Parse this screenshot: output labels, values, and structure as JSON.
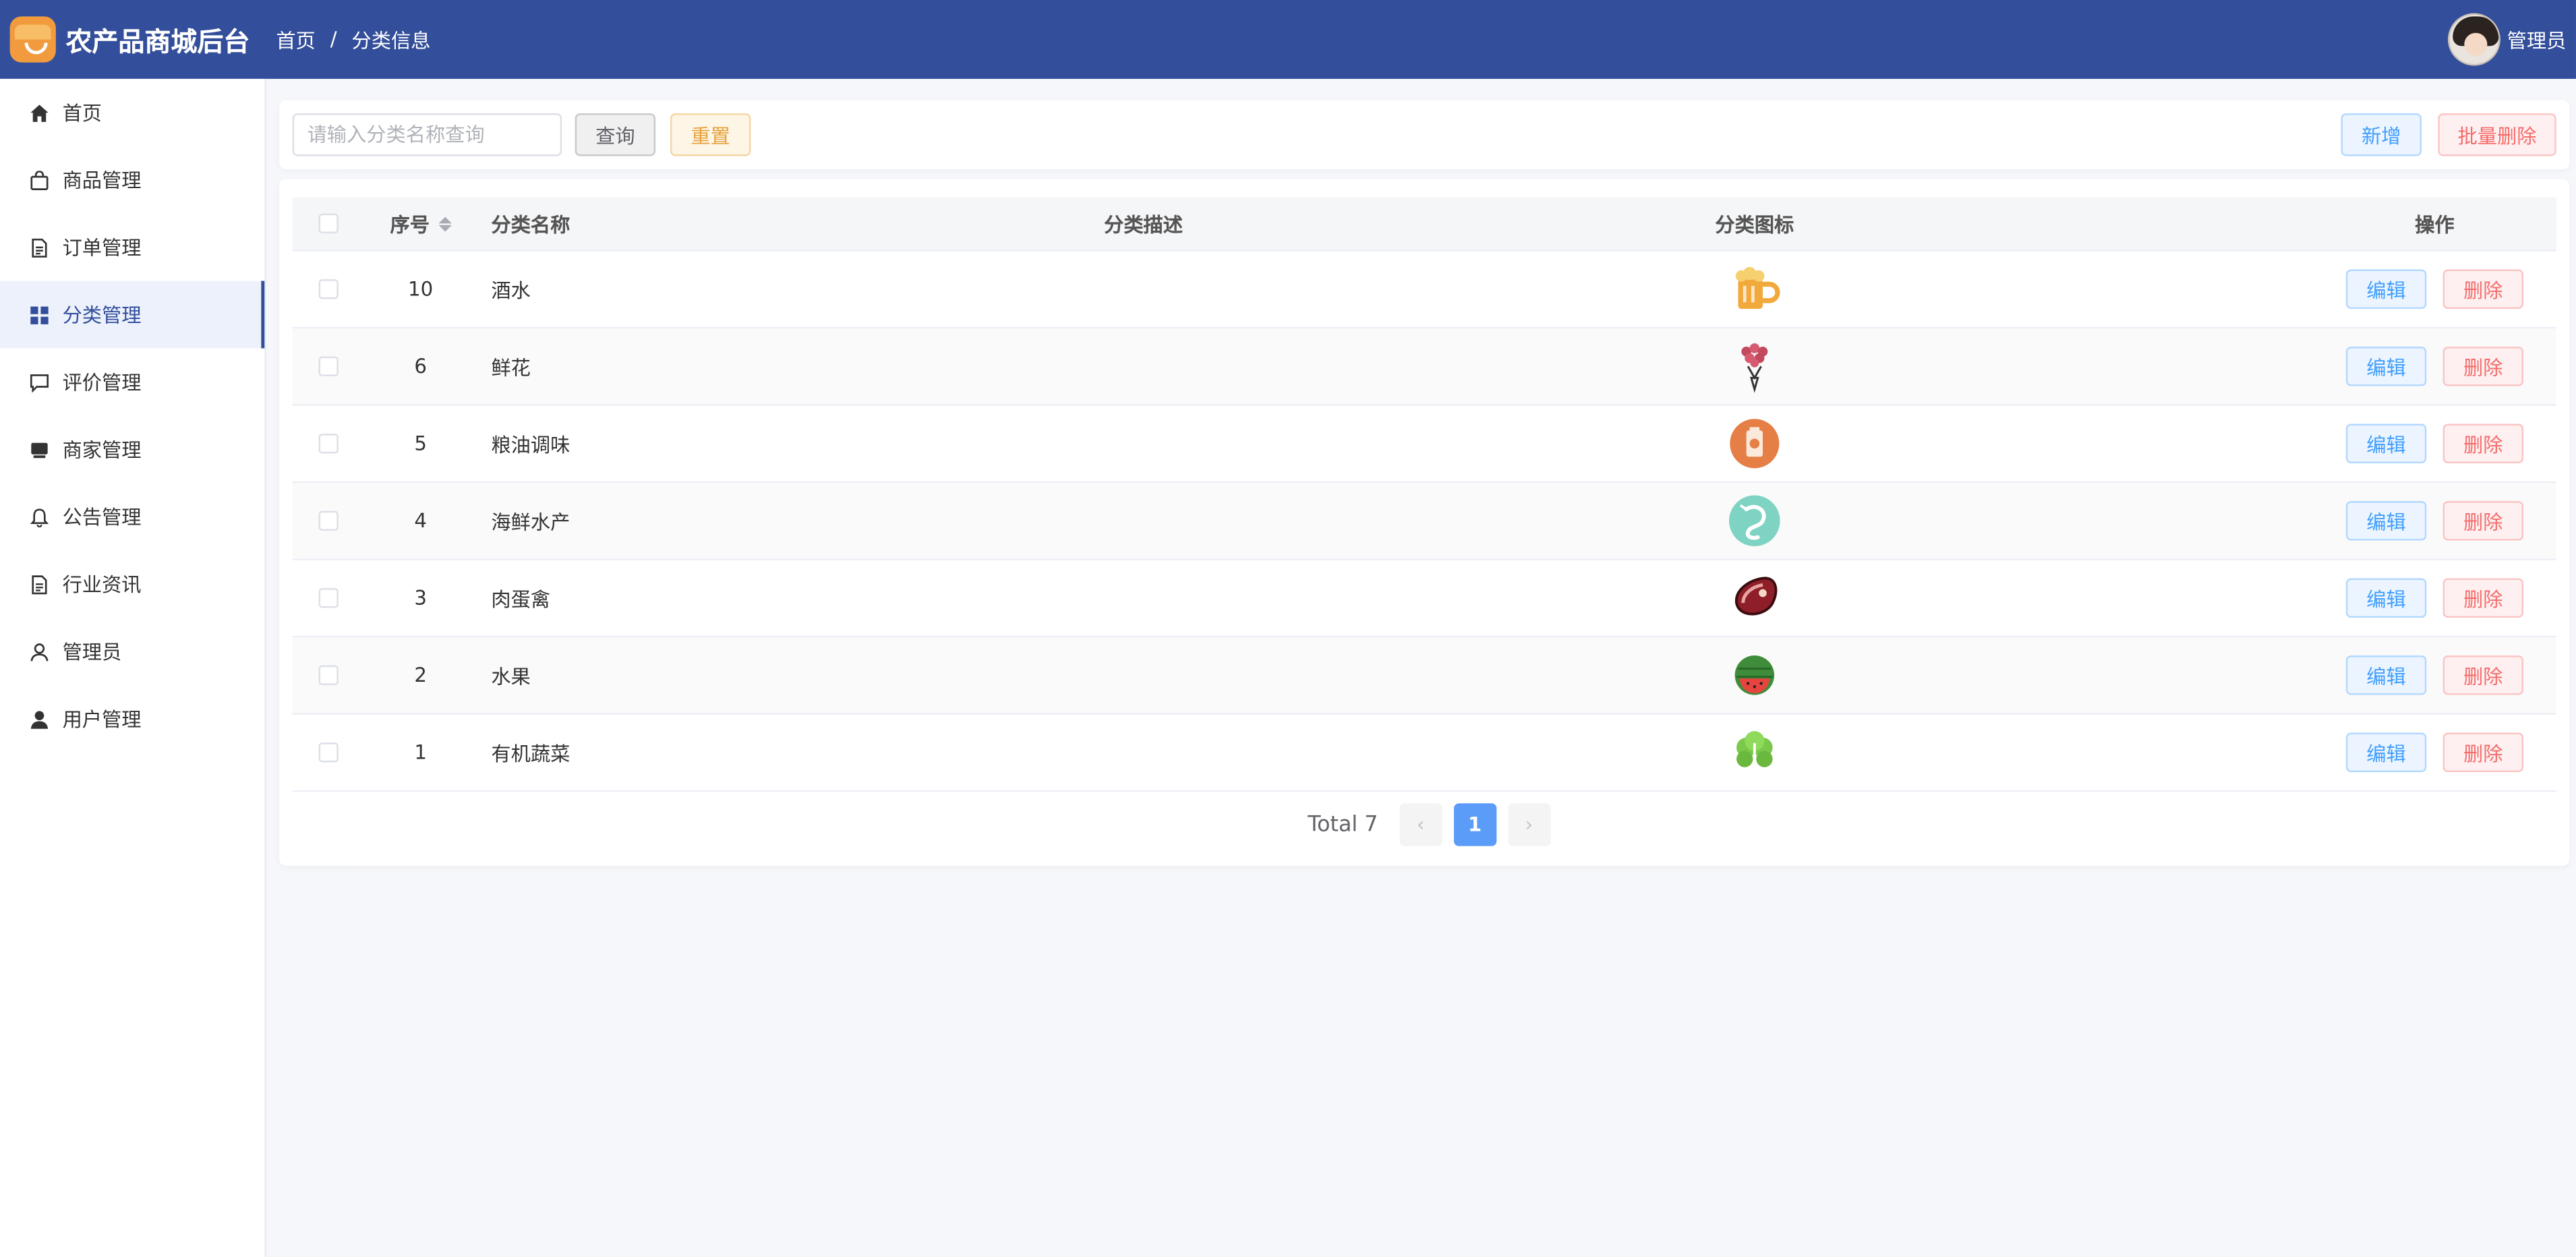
{
  "header": {
    "app_title": "农产品商城后台",
    "breadcrumb": [
      "首页",
      "分类信息"
    ],
    "user_name": "管理员",
    "bg_color": "#334e9a"
  },
  "sidebar": {
    "items": [
      {
        "label": "首页",
        "icon": "home-icon"
      },
      {
        "label": "商品管理",
        "icon": "shopping-bag-icon"
      },
      {
        "label": "订单管理",
        "icon": "document-icon"
      },
      {
        "label": "分类管理",
        "icon": "grid-icon",
        "active": true
      },
      {
        "label": "评价管理",
        "icon": "chat-icon"
      },
      {
        "label": "商家管理",
        "icon": "store-icon"
      },
      {
        "label": "公告管理",
        "icon": "bell-icon"
      },
      {
        "label": "行业资讯",
        "icon": "document-icon"
      },
      {
        "label": "管理员",
        "icon": "user-icon"
      },
      {
        "label": "用户管理",
        "icon": "user-filled-icon"
      }
    ]
  },
  "toolbar": {
    "search_placeholder": "请输入分类名称查询",
    "query_label": "查询",
    "reset_label": "重置",
    "add_label": "新增",
    "batch_delete_label": "批量删除"
  },
  "table": {
    "columns": {
      "id": "序号",
      "name": "分类名称",
      "desc": "分类描述",
      "icon": "分类图标",
      "op": "操作"
    },
    "edit_label": "编辑",
    "delete_label": "删除",
    "rows": [
      {
        "id": "10",
        "name": "酒水",
        "desc": "",
        "icon": "beer-mug-icon"
      },
      {
        "id": "6",
        "name": "鲜花",
        "desc": "",
        "icon": "flower-bouquet-icon"
      },
      {
        "id": "5",
        "name": "粮油调味",
        "desc": "",
        "icon": "oil-bottle-icon"
      },
      {
        "id": "4",
        "name": "海鲜水产",
        "desc": "",
        "icon": "shrimp-icon"
      },
      {
        "id": "3",
        "name": "肉蛋禽",
        "desc": "",
        "icon": "steak-icon"
      },
      {
        "id": "2",
        "name": "水果",
        "desc": "",
        "icon": "watermelon-icon"
      },
      {
        "id": "1",
        "name": "有机蔬菜",
        "desc": "",
        "icon": "vegetable-icon"
      }
    ]
  },
  "pagination": {
    "total_text": "Total 7",
    "prev": "‹",
    "current_page": "1",
    "next": "›"
  }
}
